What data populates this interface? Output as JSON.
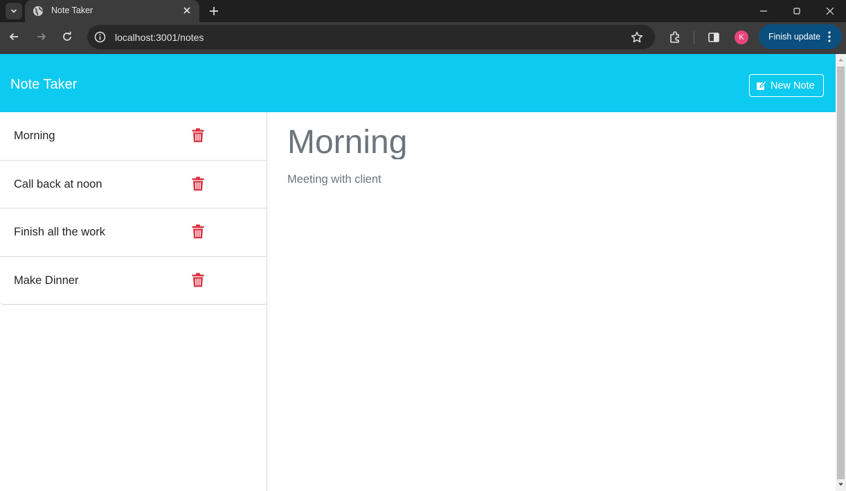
{
  "browser": {
    "tab_title": "Note Taker",
    "url": "localhost:3001/notes",
    "profile_initial": "K",
    "finish_update_label": "Finish update"
  },
  "app": {
    "brand": "Note Taker",
    "new_note_label": "New Note",
    "accent_color": "#0dcaf0",
    "delete_color": "#dc3545"
  },
  "notes": [
    {
      "title": "Morning"
    },
    {
      "title": "Call back at noon"
    },
    {
      "title": "Finish all the work"
    },
    {
      "title": "Make Dinner"
    }
  ],
  "active_note": {
    "title": "Morning",
    "text": "Meeting with client"
  }
}
